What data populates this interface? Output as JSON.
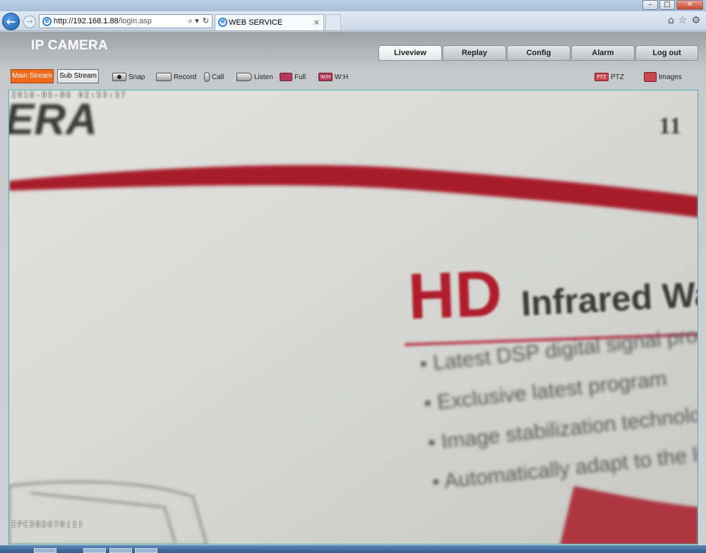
{
  "browser": {
    "address_host": "192.168.1.88",
    "address_prefix": "http://",
    "address_path": "/login.asp",
    "tab_title": "WEB SERVICE",
    "tab_close": "×",
    "addr_search": "⌕ ▾",
    "addr_refresh": "↻",
    "back_icon": "←",
    "fwd_icon": "→",
    "home_icon": "⌂",
    "fav_icon": "☆",
    "tools_icon": "⚙",
    "win_min": "–",
    "win_max": "□",
    "win_close": "✕"
  },
  "app": {
    "brand": "IP CAMERA",
    "nav": {
      "liveview": "Liveview",
      "replay": "Replay",
      "config": "Config",
      "alarm": "Alarm",
      "logout": "Log out",
      "active": "Liveview"
    },
    "toolbar": {
      "main_stream": "Main Stream",
      "sub_stream": "Sub Stream",
      "snap": "Snap",
      "record": "Record",
      "call": "Call",
      "listen": "Listen",
      "full": "Full",
      "wh": "W:H",
      "wh_icon": "W/H",
      "ptz": "PTZ",
      "ptz_icon": "PTZ",
      "images": "Images"
    }
  },
  "video": {
    "osd_time": "2016-05-06 02:55:27",
    "osd_name": "IPC385670(1)",
    "scene": {
      "era": "ERA",
      "hd": "HD",
      "infrared": "Infrared Wa",
      "badge": "11",
      "bullets": [
        "• Latest DSP digital signal proce",
        "• Exclusive latest program",
        "• Image stabilization technolog",
        "• Automatically adapt to the ligh"
      ]
    }
  }
}
